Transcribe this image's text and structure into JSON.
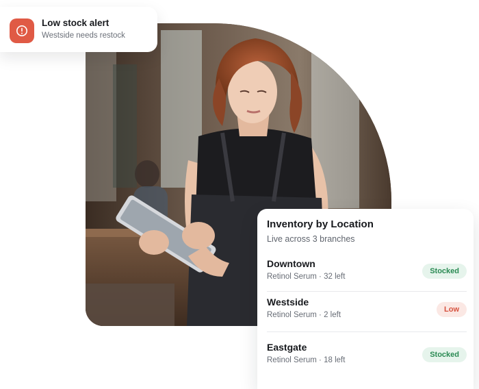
{
  "alert": {
    "icon": "alert-circle-icon",
    "title": "Low stock alert",
    "subtitle": "Westside needs restock",
    "color": "#e05a45"
  },
  "inventory": {
    "title": "Inventory by Location",
    "subtitle": "Live across 3 branches",
    "locations": [
      {
        "name": "Downtown",
        "detail": "Retinol Serum · 32 left",
        "status": "Stocked"
      },
      {
        "name": "Westside",
        "detail": "Retinol Serum · 2 left",
        "status": "Low"
      },
      {
        "name": "Eastgate",
        "detail": "Retinol Serum · 18 left",
        "status": "Stocked"
      }
    ]
  },
  "colors": {
    "stocked_badge_bg": "#e6f4ec",
    "stocked_badge_text": "#2a8a53",
    "low_badge_bg": "#fbe8e4",
    "low_badge_text": "#d6523f"
  }
}
